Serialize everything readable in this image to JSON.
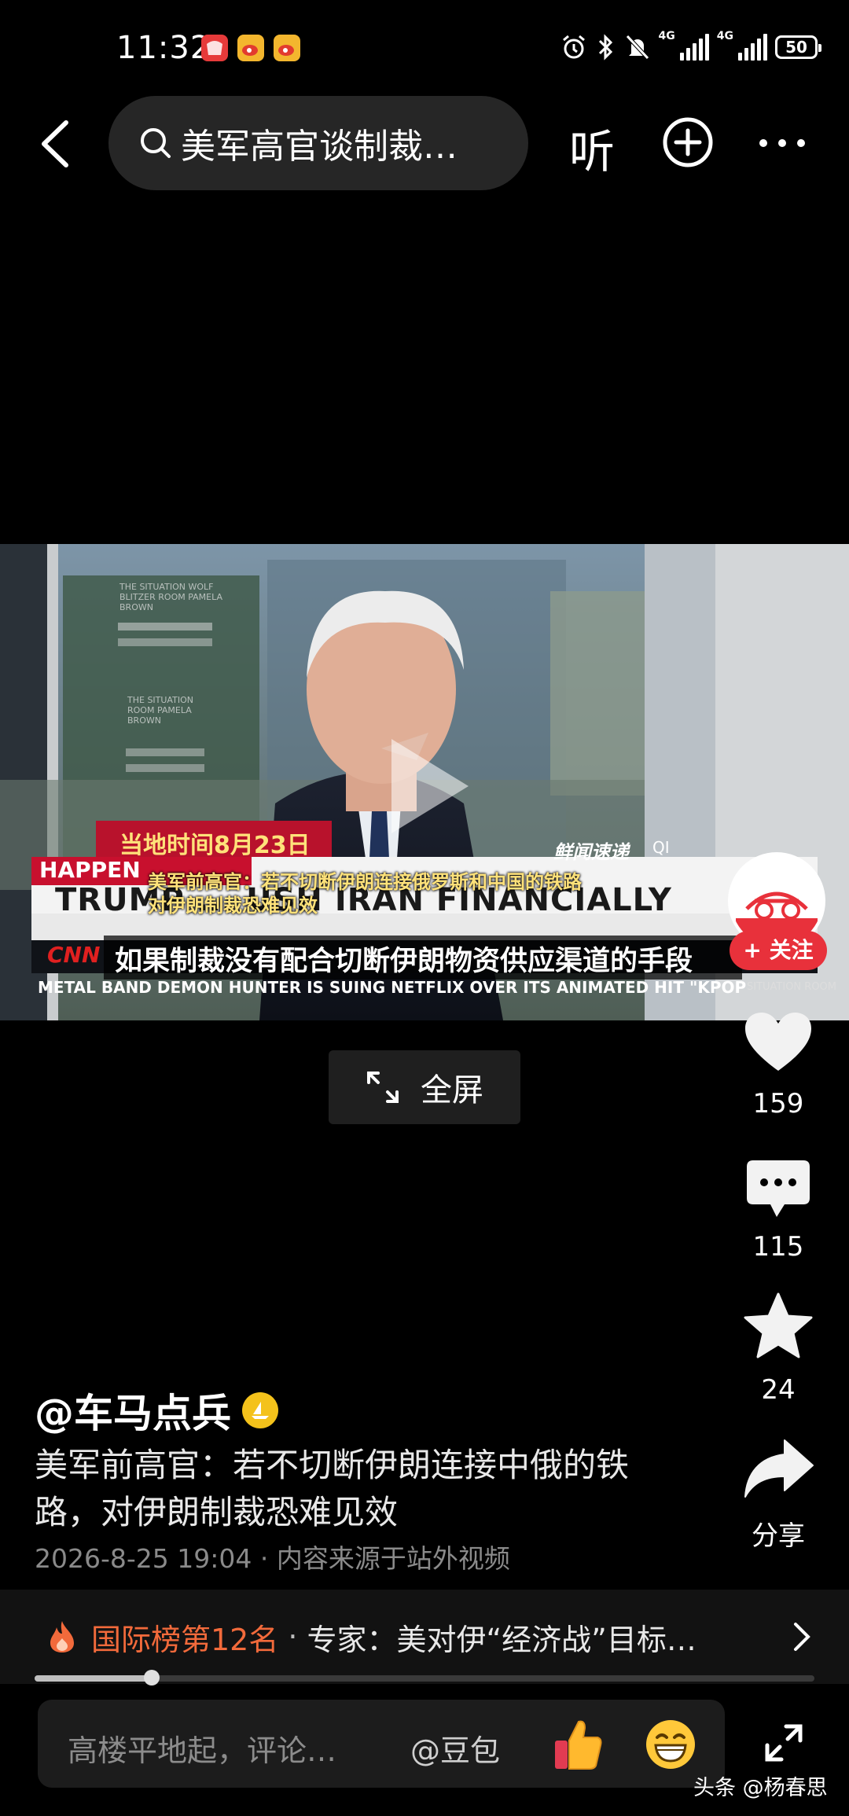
{
  "status_bar": {
    "time": "11:32",
    "battery": "50",
    "network_1": "4G",
    "network_2": "4G"
  },
  "top_nav": {
    "search_text": "美军高官谈制裁…",
    "listen_label": "听"
  },
  "video": {
    "overlay_date": "当地时间8月23日",
    "overlay_headline_1": "美军前高官：若不切断伊朗连接俄罗斯和中国的铁路",
    "overlay_headline_2": "对伊朗制裁恐难见效",
    "subtitle": "如果制裁没有配合切断伊朗物资供应渠道的手段",
    "lower_third_tag": "HAPPEN",
    "lower_third_main": "TRUMP ... USH IRAN FINANCIALLY",
    "ticker": "METAL BAND DEMON HUNTER IS SUING NETFLIX OVER ITS ANIMATED HIT \"KPOP",
    "show_tag": "SITUATION ROOM",
    "network_logo": "CNN",
    "channel_watermark": "鲜闻速递",
    "channel_watermark_2": "QI",
    "backdrop_text_1": "THE SITUATION WOLF BLITZER ROOM PAMELA BROWN",
    "backdrop_text_2": "THE SITUATION ROOM PAMELA BROWN"
  },
  "fullscreen_label": "全屏",
  "follow_label": "+ 关注",
  "rail": {
    "likes": "159",
    "comments": "115",
    "favorites": "24",
    "share_label": "分享"
  },
  "caption": {
    "author": "@车马点兵",
    "description": "美军前高官：若不切断伊朗连接中俄的铁路，对伊朗制裁恐难见效",
    "meta": "2026-8-25 19:04 · 内容来源于站外视频"
  },
  "hot_bar": {
    "rank": "国际榜第12名",
    "separator": "·",
    "title": "专家：美对伊“经济战”目标…"
  },
  "progress": 0.15,
  "comment_bar": {
    "placeholder": "高楼平地起，评论…",
    "mention": "@豆包"
  },
  "watermark": "头条 @杨春思",
  "colors": {
    "accent_red": "#e8313b",
    "hot_orange": "#f26a3b",
    "verified_yellow": "#f4c21b"
  }
}
